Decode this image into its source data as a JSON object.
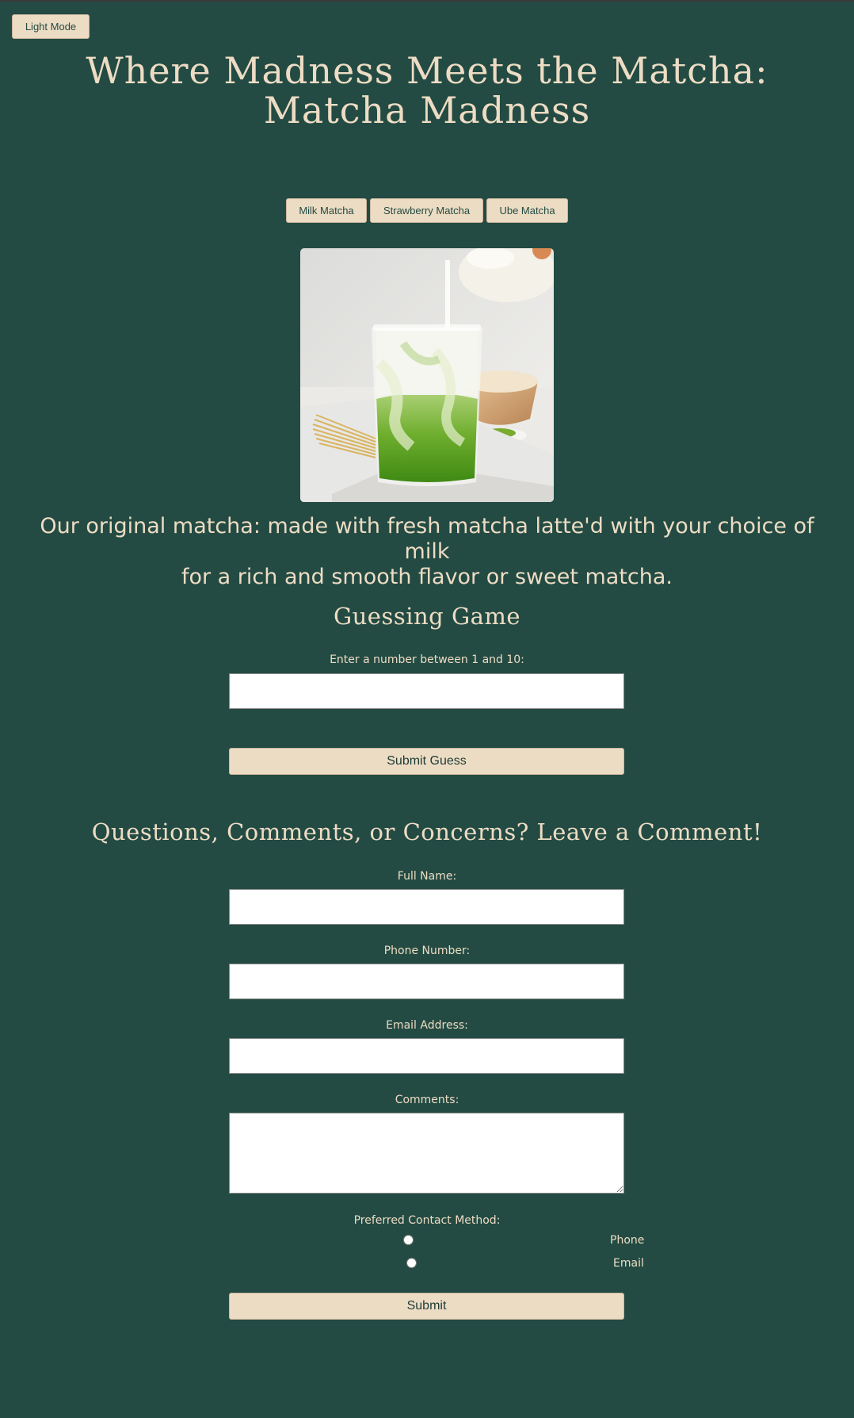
{
  "header": {
    "theme_toggle": "Light Mode",
    "title_line1": "Where Madness Meets the Matcha:",
    "title_line2": "Matcha Madness"
  },
  "tabs": [
    {
      "label": "Milk Matcha"
    },
    {
      "label": "Strawberry Matcha"
    },
    {
      "label": "Ube Matcha"
    }
  ],
  "feature": {
    "image_alt": "iced milk matcha latte",
    "description_line1": "Our original matcha: made with fresh matcha latte'd with your choice of milk",
    "description_line2": "for a rich and smooth flavor or sweet matcha."
  },
  "game": {
    "heading": "Guessing Game",
    "prompt": "Enter a number between 1 and 10:",
    "guess_value": "",
    "submit_label": "Submit Guess"
  },
  "contact": {
    "heading": "Questions, Comments, or Concerns? Leave a Comment!",
    "name_label": "Full Name:",
    "phone_label": "Phone Number:",
    "email_label": "Email Address:",
    "comments_label": "Comments:",
    "method_label": "Preferred Contact Method:",
    "method_options": [
      "Phone",
      "Email"
    ],
    "submit_label": "Submit"
  },
  "colors": {
    "background": "#234b43",
    "accent": "#ecdcc4",
    "text": "#eddcc4"
  }
}
